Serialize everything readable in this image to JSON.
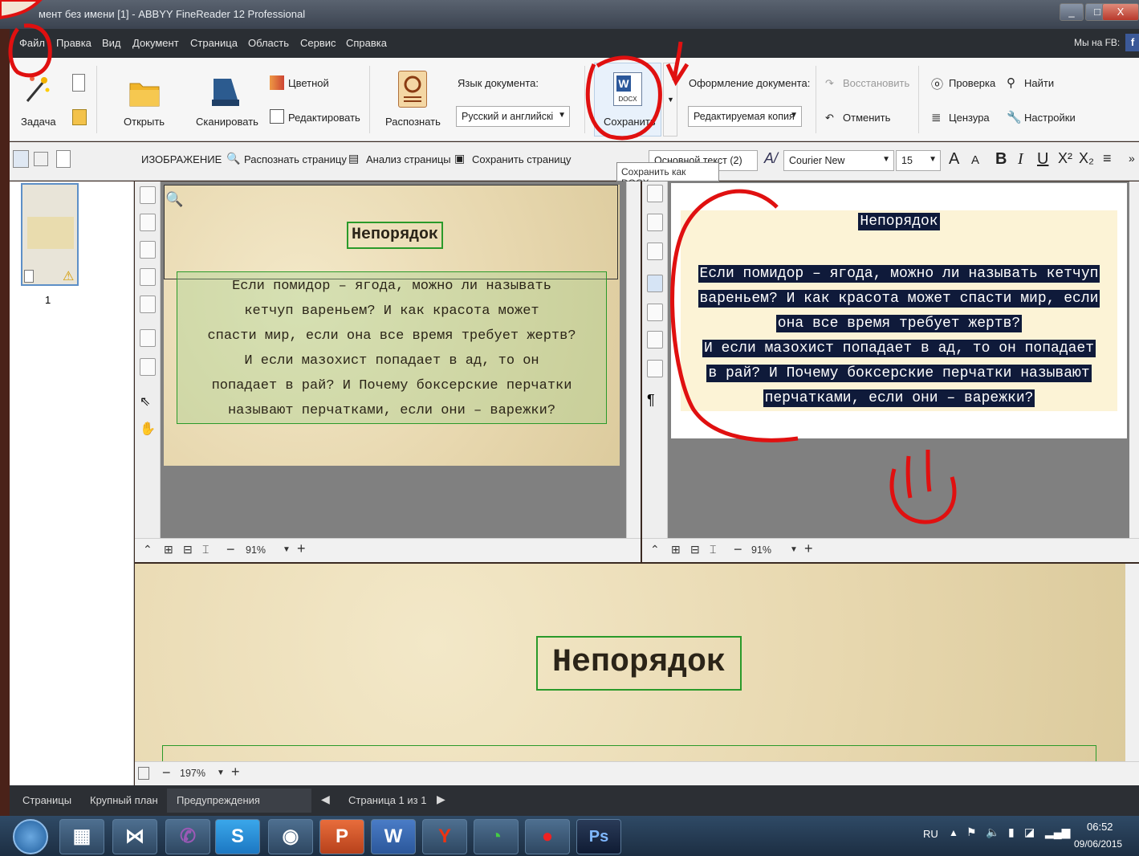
{
  "window": {
    "title": "мент без имени [1] - ABBYY FineReader 12 Professional",
    "controls": [
      "_",
      "□",
      "X"
    ]
  },
  "menu": {
    "items": [
      "Файл",
      "Правка",
      "Вид",
      "Документ",
      "Страница",
      "Область",
      "Сервис",
      "Справка"
    ],
    "right_label": "Мы на FB:",
    "fb_icon": "f"
  },
  "ribbon": {
    "task_label": "Задача",
    "open_label": "Открыть",
    "scan_label": "Сканировать",
    "color_label": "Цветной",
    "edit_label": "Редактировать",
    "recognize_label": "Распознать",
    "doc_lang_label": "Язык документа:",
    "doc_lang_value": "Русский и английскі",
    "save_label": "Сохранить",
    "docx_badge": "DOCX",
    "doc_format_label": "Оформление документа:",
    "doc_format_value": "Редактируемая копия",
    "restore_label": "Восстановить",
    "undo_label": "Отменить",
    "check_label": "Проверка",
    "censor_label": "Цензура",
    "find_label": "Найти",
    "settings_label": "Настройки"
  },
  "toolbar2": {
    "image_label": "ИЗОБРАЖЕНИЕ",
    "recognize_page": "Распознать страницу",
    "analyze_page": "Анализ страницы",
    "save_page": "Сохранить страницу",
    "style_value": "Основной текст (2)",
    "font_value": "Courier New",
    "size_value": "15",
    "tooltip": "Сохранить как DOCX"
  },
  "pages": {
    "page_number": "1"
  },
  "image_view": {
    "heading": "Непорядок",
    "body_lines": [
      "Если помидор – ягода, можно ли называть",
      "кетчуп вареньем? И как красота может",
      "спасти мир, если она все время требует жертв?",
      "И если мазохист попадает в ад, то он",
      "попадает в рай? И Почему боксерские перчатки",
      "называют перчатками, если они – варежки?"
    ],
    "zoom": "91%"
  },
  "text_view": {
    "heading": "Непорядок",
    "body_lines": [
      "Если помидор – ягода, можно ли называть кетчуп",
      "вареньем? И как красота может спасти мир, если",
      "она все время требует жертв?",
      "И если мазохист попадает в ад, то он попадает",
      "в рай? И Почему боксерские перчатки называют",
      "перчатками, если они – варежки?"
    ],
    "zoom": "91%"
  },
  "zoom_view": {
    "heading": "Непорядок",
    "zoom": "197%"
  },
  "bottom_tabs": {
    "pages": "Страницы",
    "closeup": "Крупный план",
    "warnings": "Предупреждения",
    "page_counter": "Страница 1 из 1"
  },
  "taskbar": {
    "lang": "RU",
    "time": "06:52",
    "date": "09/06/2015",
    "apps": [
      "explorer",
      "visual-studio",
      "viber",
      "skype",
      "chrome",
      "powerpoint",
      "word",
      "yandex",
      "monitor",
      "bandicam",
      "photoshop"
    ]
  },
  "colors": {
    "annotation_red": "#e01010",
    "selection_green": "#2a9a2a",
    "text_highlight": "#0f1a3a"
  }
}
